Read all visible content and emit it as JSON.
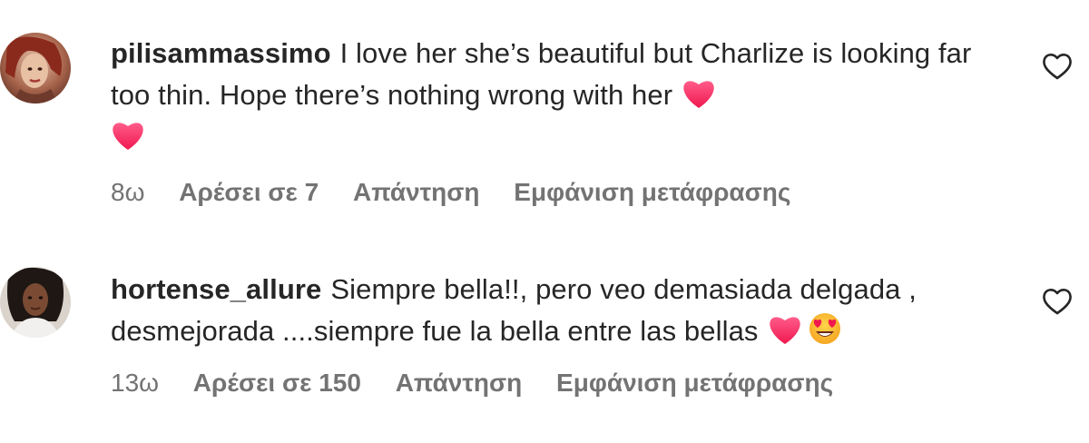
{
  "comments": [
    {
      "username": "pilisammassimo",
      "text_line1": "I love her she’s beautiful but Charlize is looking far too thin. Hope there’s nothing wrong with her",
      "emojis": [
        "red-heart-emoji",
        "red-heart-emoji"
      ],
      "time": "8ω",
      "likes": "Αρέσει σε 7",
      "reply": "Απάντηση",
      "translation": "Εμφάνιση μετάφρασης"
    },
    {
      "username": "hortense_allure",
      "text_line1": "Siempre bella!!, pero veo demasiada delgada , desmejorada ....siempre fue la bella entre las bellas",
      "emojis": [
        "red-heart-emoji",
        "heart-eyes-emoji"
      ],
      "time": "13ω",
      "likes": "Αρέσει σε 150",
      "reply": "Απάντηση",
      "translation": "Εμφάνιση μετάφρασης"
    }
  ],
  "colors": {
    "text": "#262626",
    "meta": "#737373",
    "heart": "#ff3b6b",
    "background": "#ffffff"
  }
}
